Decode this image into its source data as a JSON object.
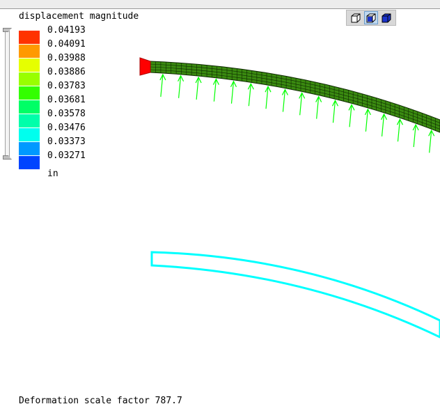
{
  "legend": {
    "title": "displacement magnitude",
    "units": "in",
    "entries": [
      {
        "value": "0.04193",
        "color": "#ff3300"
      },
      {
        "value": "0.04091",
        "color": "#ff9900"
      },
      {
        "value": "0.03988",
        "color": "#e6ff00"
      },
      {
        "value": "0.03886",
        "color": "#99ff00"
      },
      {
        "value": "0.03783",
        "color": "#33ff00"
      },
      {
        "value": "0.03681",
        "color": "#00ff66"
      },
      {
        "value": "0.03578",
        "color": "#00ffaa"
      },
      {
        "value": "0.03476",
        "color": "#00ffee"
      },
      {
        "value": "0.03373",
        "color": "#0099ff"
      },
      {
        "value": "0.03271",
        "color": "#0044ff"
      }
    ]
  },
  "footer": {
    "scale_label": "Deformation scale factor 787.7"
  },
  "view_toolbar": {
    "buttons": [
      {
        "icon": "wireframe-cube-icon",
        "active": false
      },
      {
        "icon": "shaded-cube-icon",
        "active": true
      },
      {
        "icon": "solid-cube-icon",
        "active": false
      }
    ]
  },
  "colors": {
    "deformed_fill": "#3a8a10",
    "undeformed_outline": "#00ffff",
    "load_arrow": "#00ff00",
    "constraint": "#ff0000"
  }
}
